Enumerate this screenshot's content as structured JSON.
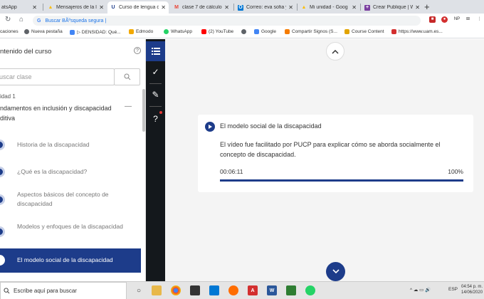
{
  "browser": {
    "tabs": [
      {
        "title": "atsApp",
        "favicon": "whatsapp-icon",
        "color": "#25d366"
      },
      {
        "title": "Mensajeros de la l",
        "favicon": "drive-icon",
        "color": "#fbbc04"
      },
      {
        "title": "Curso de lengua d",
        "favicon": "course-icon",
        "color": "#1d3c8a",
        "active": true
      },
      {
        "title": "clase 7 de cálculo",
        "favicon": "gmail-icon",
        "color": "#ea4335"
      },
      {
        "title": "Correo: eva sofia y",
        "favicon": "outlook-icon",
        "color": "#0078d4"
      },
      {
        "title": "Mi unidad - Goog",
        "favicon": "drive-icon",
        "color": "#fbbc04"
      },
      {
        "title": "Crear Publique | W",
        "favicon": "publique-icon",
        "color": "#7b3fa0"
      }
    ],
    "new_tab": "+",
    "address": "Buscar BÃºsqueda segura |",
    "address_prefix": "G",
    "extensions": [
      "NP",
      "⊞",
      "⋮"
    ],
    "bookmarks": [
      {
        "label": "caciones",
        "color": "#4285f4"
      },
      {
        "label": "Nueva pestaña",
        "color": "#5f6368"
      },
      {
        "label": "▷ DENSIDAD: Qué...",
        "color": "#4285f4"
      },
      {
        "label": "Edmodo",
        "color": "#f2a900"
      },
      {
        "label": "WhatsApp",
        "color": "#25d366"
      },
      {
        "label": "(2) YouTube",
        "color": "#ff0000"
      },
      {
        "label": "",
        "color": "#5f6368"
      },
      {
        "label": "Google",
        "color": "#4285f4"
      },
      {
        "label": "Compartir Signos (S...",
        "color": "#f57c00"
      },
      {
        "label": "Course Content",
        "color": "#e2a400"
      },
      {
        "label": "https://www.uam.es...",
        "color": "#d32f2f"
      }
    ]
  },
  "sidebar": {
    "title": "ntenido del curso",
    "search_placeholder": "uscar clase",
    "unit_label": "idad 1",
    "unit_name": "ndamentos en inclusión y discapacidad ditiva",
    "lessons": [
      {
        "label": "Historia de la discapacidad",
        "active": false
      },
      {
        "label": "¿Qué es la discapacidad?",
        "active": false
      },
      {
        "label": "Aspectos básicos del concepto de discapacidad",
        "active": false
      },
      {
        "label": "Modelos y enfoques de la discapacidad",
        "active": false
      },
      {
        "label": "El modelo social de la discapacidad",
        "active": true
      }
    ]
  },
  "tools": {
    "menu_icon": "☰",
    "check_icon": "✓",
    "edit_icon": "✎",
    "help_icon": "?"
  },
  "content": {
    "title": "El modelo social de la discapacidad",
    "description": "El vídeo fue facilitado por PUCP para explicar cómo se aborda socialmente el concepto de discapacidad.",
    "time": "00:06:11",
    "percent": "100%",
    "progress_fraction": 1.0
  },
  "taskbar": {
    "search_text": "Escribe aquí para buscar",
    "language": "ESP",
    "time": "04:54 p. m.",
    "date": "14/06/2020"
  },
  "colors": {
    "accent": "#1d3c8a",
    "dark_bar": "#14181c",
    "background": "#f4f4f4"
  }
}
